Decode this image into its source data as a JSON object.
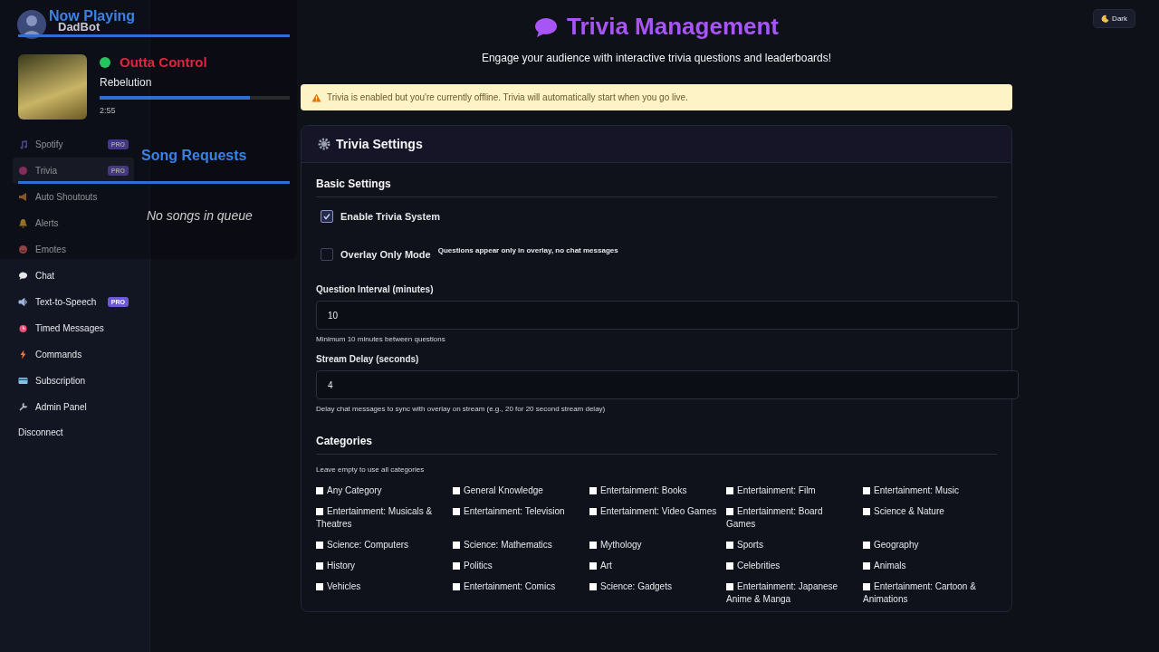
{
  "theme_button": {
    "label": "Dark"
  },
  "sidebar": {
    "items": [
      {
        "label": "Spotify",
        "badge": "PRO",
        "selected": false
      },
      {
        "label": "Trivia",
        "badge": "PRO",
        "selected": true
      },
      {
        "label": "Auto Shoutouts",
        "selected": false
      },
      {
        "label": "Alerts",
        "selected": false
      },
      {
        "label": "Emotes",
        "selected": false
      },
      {
        "label": "Chat",
        "selected": false
      },
      {
        "label": "Text-to-Speech",
        "badge": "PRO",
        "selected": false
      },
      {
        "label": "Timed Messages",
        "selected": false
      },
      {
        "label": "Commands",
        "selected": false
      },
      {
        "label": "Subscription",
        "selected": false
      },
      {
        "label": "Admin Panel",
        "selected": false
      }
    ],
    "disconnect": "Disconnect"
  },
  "overlay": {
    "now_playing_title": "Now Playing",
    "bot_name": "DadBot",
    "song_title": "Outta Control",
    "artist": "Rebelution",
    "level": 0.79,
    "time": "2:55",
    "requests_title": "Song Requests",
    "empty_text": "No songs in queue"
  },
  "header": {
    "title": "Trivia Management",
    "subtitle": "Engage your audience with interactive trivia questions and leaderboards!"
  },
  "notice": "Trivia is enabled but you're currently offline. Trivia will automatically start when you go live.",
  "settings": {
    "title": "Trivia Settings",
    "basic_title": "Basic Settings",
    "toggles": [
      {
        "label": "Enable Trivia System",
        "checked": true
      },
      {
        "label": "Overlay Only Mode",
        "hint": "Questions appear only in overlay, no chat messages",
        "checked": false
      }
    ],
    "fields": [
      {
        "label": "Question Interval (minutes)",
        "value": "10",
        "help": "Minimum 10 minutes between questions"
      },
      {
        "label": "Stream Delay (seconds)",
        "value": "4",
        "help": "Delay chat messages to sync with overlay on stream (e.g., 20 for 20 second stream delay)"
      }
    ],
    "categories_title": "Categories",
    "categories_help": "Leave empty to use all categories",
    "categories": [
      {
        "label": "Any Category",
        "checked": false
      },
      {
        "label": "General Knowledge",
        "checked": false
      },
      {
        "label": "Entertainment: Books",
        "checked": false
      },
      {
        "label": "Entertainment: Film",
        "checked": false
      },
      {
        "label": "Entertainment: Music",
        "checked": false
      },
      {
        "label": "Entertainment: Musicals & Theatres",
        "checked": false
      },
      {
        "label": "Entertainment: Television",
        "checked": false
      },
      {
        "label": "Entertainment: Video Games",
        "checked": false
      },
      {
        "label": "Entertainment: Board Games",
        "checked": false
      },
      {
        "label": "Science & Nature",
        "checked": false
      },
      {
        "label": "Science: Computers",
        "checked": false
      },
      {
        "label": "Science: Mathematics",
        "checked": false
      },
      {
        "label": "Mythology",
        "checked": false
      },
      {
        "label": "Sports",
        "checked": false
      },
      {
        "label": "Geography",
        "checked": false
      },
      {
        "label": "History",
        "checked": false
      },
      {
        "label": "Politics",
        "checked": false
      },
      {
        "label": "Art",
        "checked": false
      },
      {
        "label": "Celebrities",
        "checked": false
      },
      {
        "label": "Animals",
        "checked": false
      },
      {
        "label": "Vehicles",
        "checked": false
      },
      {
        "label": "Entertainment: Comics",
        "checked": false
      },
      {
        "label": "Science: Gadgets",
        "checked": false
      },
      {
        "label": "Entertainment: Japanese Anime & Manga",
        "checked": false
      },
      {
        "label": "Entertainment: Cartoon & Animations",
        "checked": false
      }
    ]
  }
}
